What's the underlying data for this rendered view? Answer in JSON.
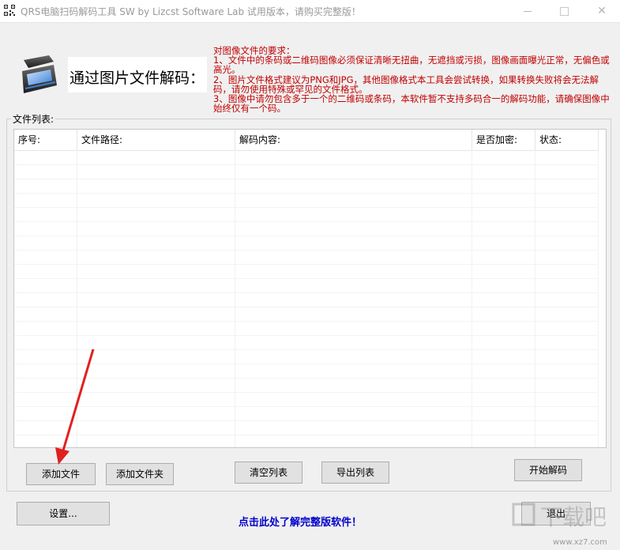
{
  "window": {
    "title": "QRS电脑扫码解码工具  SW  by Lizcst Software Lab 试用版本，请购买完整版！"
  },
  "header": {
    "title": "通过图片文件解码："
  },
  "requirements": {
    "heading": "对图像文件的要求：",
    "line1": "1、文件中的条码或二维码图像必须保证清晰无扭曲，无遮挡或污损，图像画面曝光正常，无偏色或高光。",
    "line2": "2、图片文件格式建议为PNG和JPG，其他图像格式本工具会尝试转换，如果转换失败将会无法解码，请勿使用特殊或罕见的文件格式。",
    "line3": "3、图像中请勿包含多于一个的二维码或条码，本软件暂不支持多码合一的解码功能，请确保图像中始终仅有一个码。"
  },
  "file_list": {
    "group_label": "文件列表:",
    "columns": [
      "序号:",
      "文件路径:",
      "解码内容:",
      "是否加密:",
      "状态:"
    ]
  },
  "buttons": {
    "add_file": "添加文件",
    "add_folder": "添加文件夹",
    "clear_list": "清空列表",
    "export_list": "导出列表",
    "start_decode": "开始解码",
    "settings": "设置...",
    "exit": "退出"
  },
  "footer": {
    "full_version_link": "点击此处了解完整版软件！"
  },
  "colors": {
    "requirements_text": "#c00000",
    "link_text": "#0000cc",
    "annotation_arrow": "#e02020"
  },
  "watermark": {
    "text": "www.xz7.com"
  }
}
